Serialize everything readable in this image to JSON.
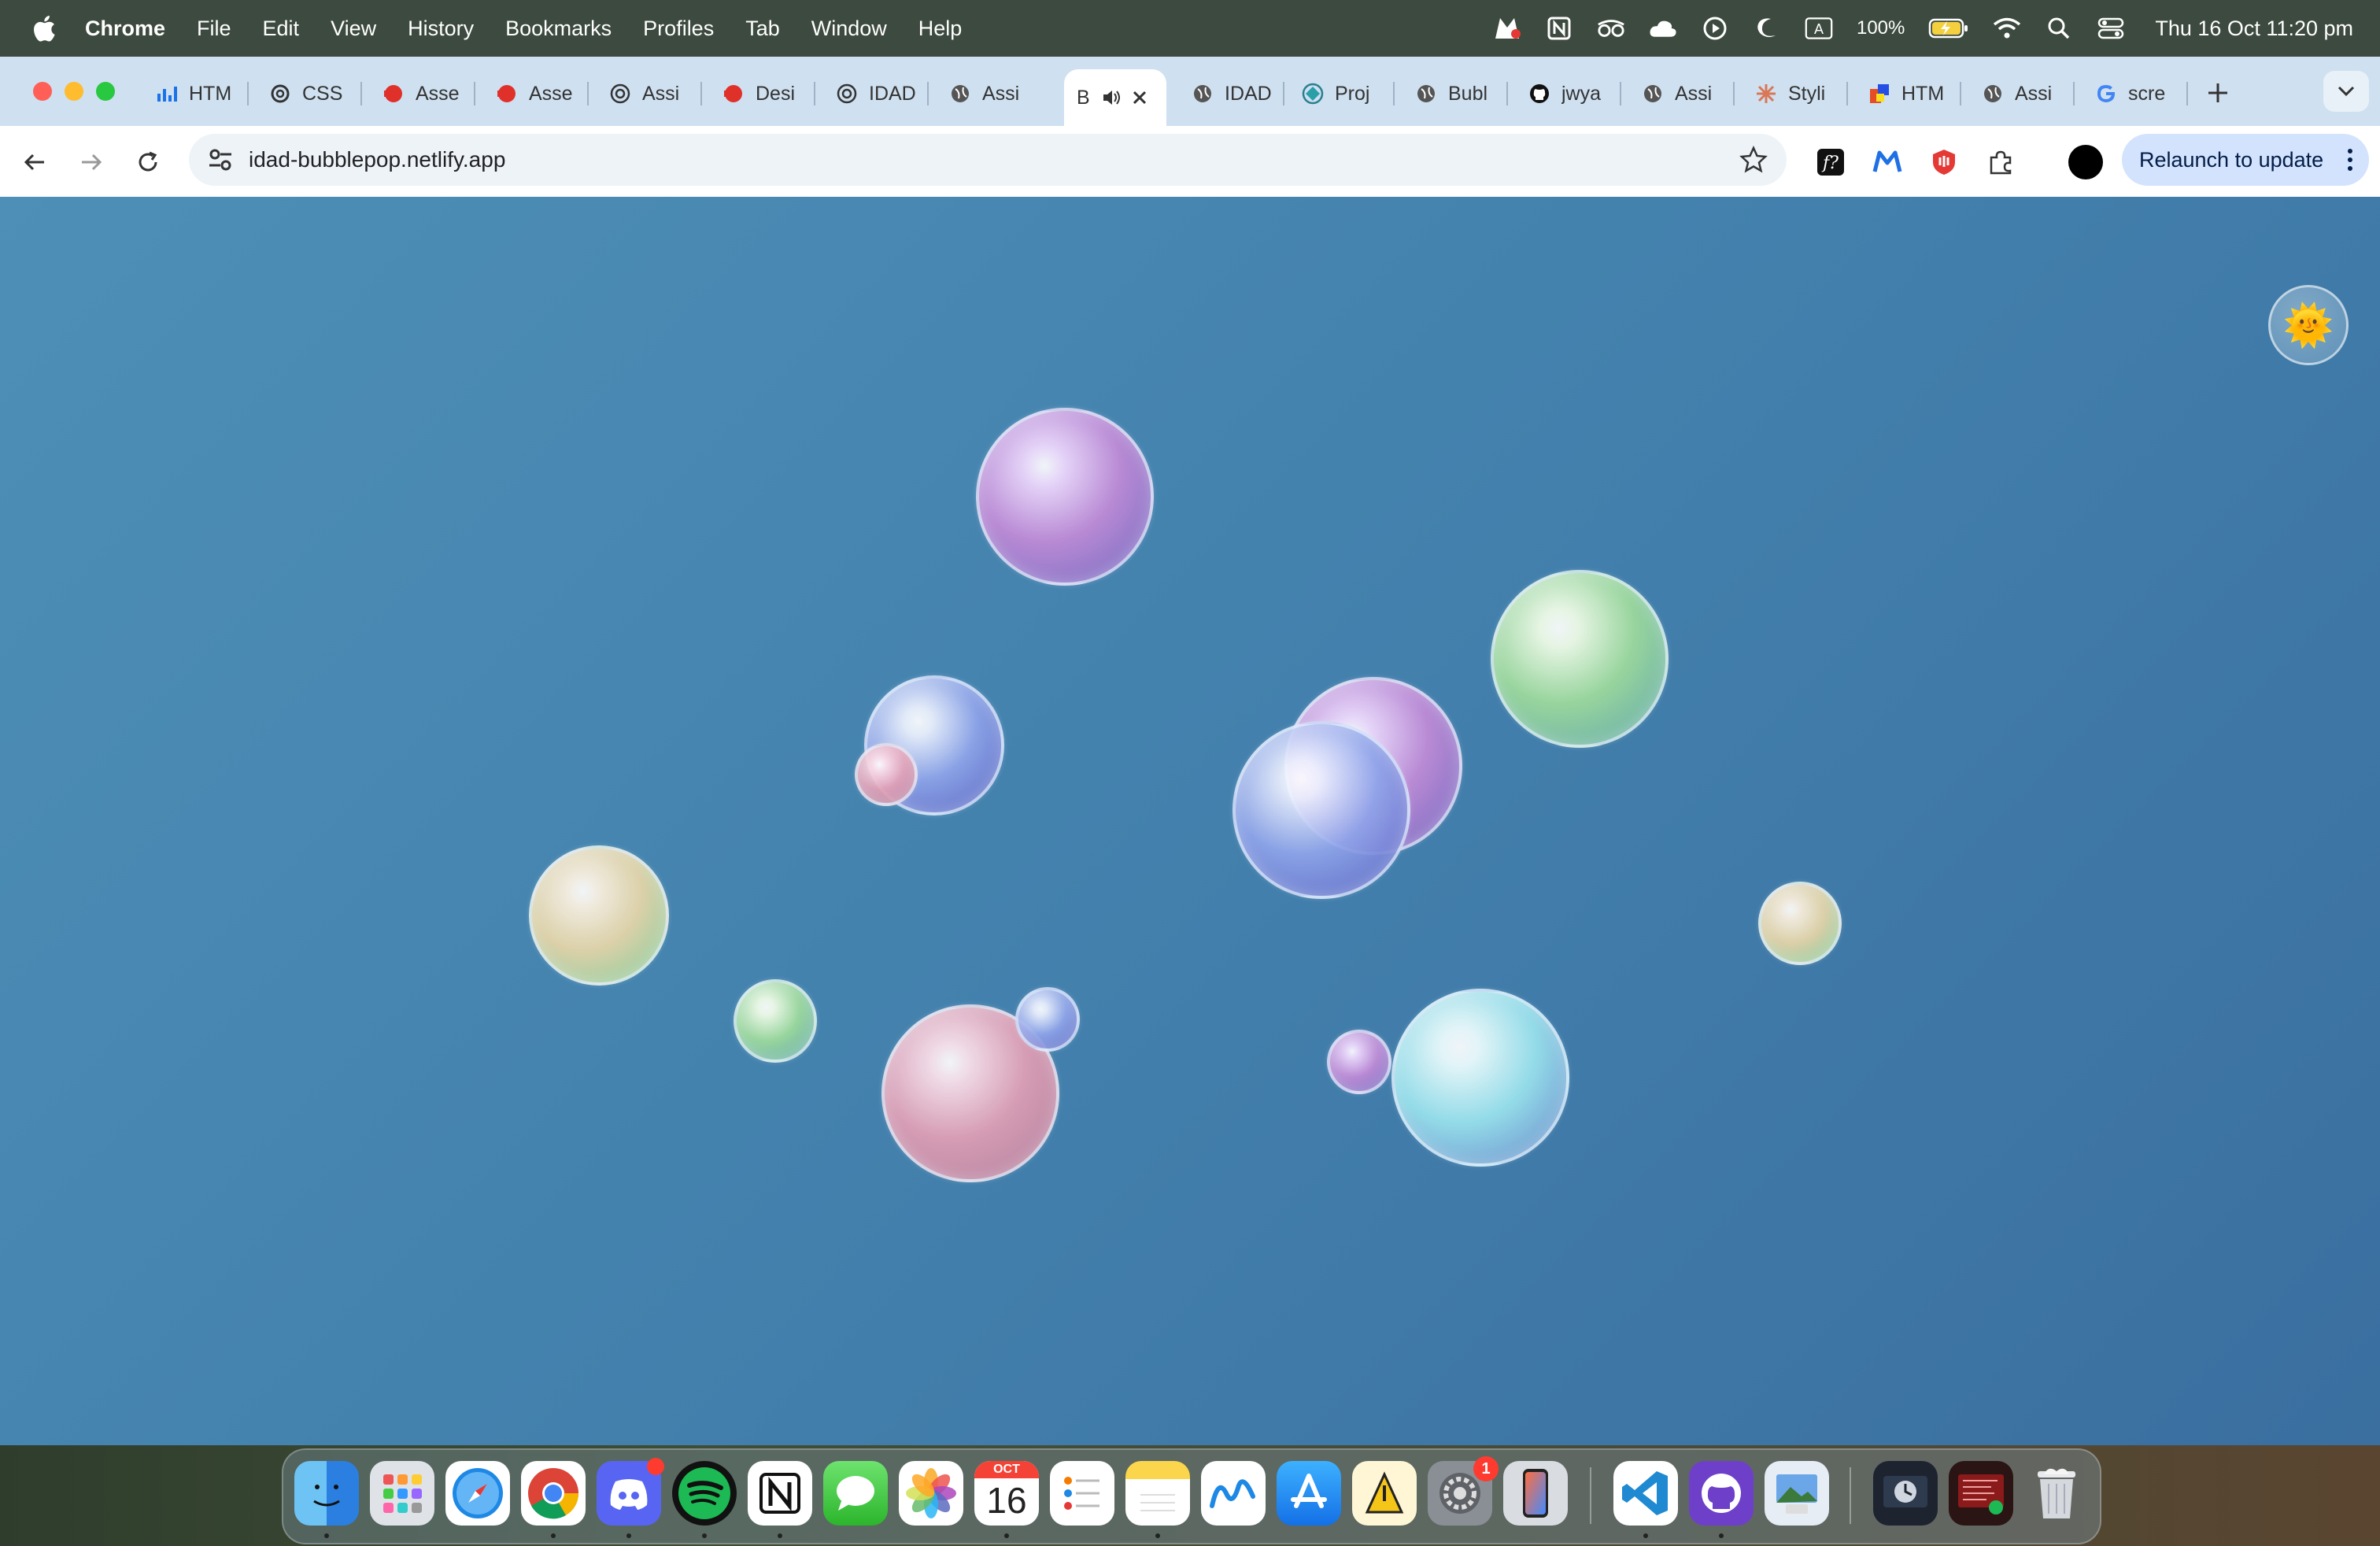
{
  "menubar": {
    "app_name": "Chrome",
    "menus": [
      "File",
      "Edit",
      "View",
      "History",
      "Bookmarks",
      "Profiles",
      "Tab",
      "Window",
      "Help"
    ],
    "battery_percent": "100%",
    "input_source": "A",
    "clock": "Thu 16 Oct  11:20 pm"
  },
  "tabs": [
    {
      "label": "HTM",
      "icon": "bar-chart-icon"
    },
    {
      "label": "CSS",
      "icon": "openai-icon"
    },
    {
      "label": "Asse",
      "icon": "red-shape-icon"
    },
    {
      "label": "Asse",
      "icon": "red-shape-icon"
    },
    {
      "label": "Assi",
      "icon": "openai-icon"
    },
    {
      "label": "Desi",
      "icon": "red-shape-icon"
    },
    {
      "label": "IDAD",
      "icon": "openai-icon"
    },
    {
      "label": "Assi",
      "icon": "globe-icon"
    },
    {
      "label": "B",
      "icon": "",
      "active": true
    },
    {
      "label": "IDAD",
      "icon": "globe-icon"
    },
    {
      "label": "Proj",
      "icon": "diamond-icon"
    },
    {
      "label": "Bubl",
      "icon": "globe-icon"
    },
    {
      "label": "jwya",
      "icon": "github-icon"
    },
    {
      "label": "Assi",
      "icon": "globe-icon"
    },
    {
      "label": "Styli",
      "icon": "claude-icon"
    },
    {
      "label": "HTM",
      "icon": "colorful-icon"
    },
    {
      "label": "Assi",
      "icon": "globe-icon"
    },
    {
      "label": "scre",
      "icon": "google-icon"
    }
  ],
  "toolbar": {
    "url": "idad-bubblepop.netlify.app",
    "relaunch_label": "Relaunch to update"
  },
  "page": {
    "theme_toggle_emoji": "🌞",
    "bubbles": [
      {
        "color": "purple"
      },
      {
        "color": "blue"
      },
      {
        "color": "pink"
      },
      {
        "color": "green"
      },
      {
        "color": "purple"
      },
      {
        "color": "blue"
      },
      {
        "color": "peach"
      },
      {
        "color": "green"
      },
      {
        "color": "pink"
      },
      {
        "color": "peach"
      },
      {
        "color": "blue"
      },
      {
        "color": "purple"
      },
      {
        "color": "cyan"
      }
    ]
  },
  "dock": {
    "apps": [
      {
        "name": "finder",
        "running": true
      },
      {
        "name": "launchpad",
        "running": false
      },
      {
        "name": "safari",
        "running": false
      },
      {
        "name": "chrome",
        "running": true
      },
      {
        "name": "discord",
        "running": true,
        "badge": ""
      },
      {
        "name": "spotify",
        "running": true
      },
      {
        "name": "notion",
        "running": true
      },
      {
        "name": "messages",
        "running": false
      },
      {
        "name": "photos",
        "running": false
      },
      {
        "name": "calendar",
        "running": true,
        "month": "OCT",
        "day": "16"
      },
      {
        "name": "reminders",
        "running": false
      },
      {
        "name": "notes",
        "running": true
      },
      {
        "name": "freeform",
        "running": false
      },
      {
        "name": "app-store",
        "running": false
      },
      {
        "name": "instruments",
        "running": false
      },
      {
        "name": "system-settings",
        "running": false,
        "badge": "1"
      },
      {
        "name": "iphone-mirroring",
        "running": false
      },
      {
        "name": "vscode",
        "running": true
      },
      {
        "name": "github-desktop",
        "running": true
      },
      {
        "name": "preview",
        "running": false
      },
      {
        "name": "screen-time",
        "running": false
      },
      {
        "name": "terminal",
        "running": false
      },
      {
        "name": "trash",
        "running": false
      }
    ]
  }
}
